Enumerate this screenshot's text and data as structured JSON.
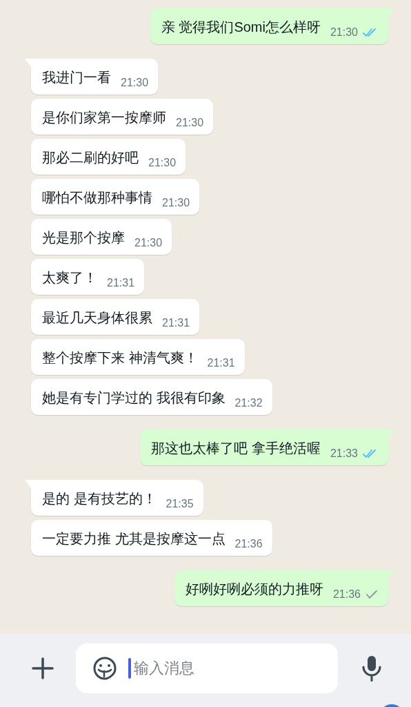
{
  "messages": [
    {
      "outgoing": true,
      "tail": true,
      "text": "亲 觉得我们Somi怎么样呀",
      "time": "21:30",
      "read": true
    },
    {
      "outgoing": false,
      "tail": true,
      "text": "我进门一看",
      "time": "21:30"
    },
    {
      "outgoing": false,
      "tail": false,
      "text": "是你们家第一按摩师",
      "time": "21:30"
    },
    {
      "outgoing": false,
      "tail": false,
      "text": "那必二刷的好吧",
      "time": "21:30"
    },
    {
      "outgoing": false,
      "tail": false,
      "text": "哪怕不做那种事情",
      "time": "21:30"
    },
    {
      "outgoing": false,
      "tail": false,
      "text": "光是那个按摩",
      "time": "21:30"
    },
    {
      "outgoing": false,
      "tail": false,
      "text": "太爽了！",
      "time": "21:31"
    },
    {
      "outgoing": false,
      "tail": false,
      "text": "最近几天身体很累",
      "time": "21:31"
    },
    {
      "outgoing": false,
      "tail": false,
      "text": "整个按摩下来 神清气爽！",
      "time": "21:31"
    },
    {
      "outgoing": false,
      "tail": false,
      "text": "她是有专门学过的 我很有印象",
      "time": "21:32"
    },
    {
      "outgoing": true,
      "tail": true,
      "text": "那这也太棒了吧 拿手绝活喔",
      "time": "21:33",
      "read": true
    },
    {
      "outgoing": false,
      "tail": true,
      "text": "是的 是有技艺的！",
      "time": "21:35"
    },
    {
      "outgoing": false,
      "tail": false,
      "text": "一定要力推 尤其是按摩这一点",
      "time": "21:36"
    },
    {
      "outgoing": true,
      "tail": true,
      "text": "好咧好咧必须的力推呀",
      "time": "21:36",
      "read": false
    }
  ],
  "composer": {
    "placeholder": "输入消息"
  }
}
